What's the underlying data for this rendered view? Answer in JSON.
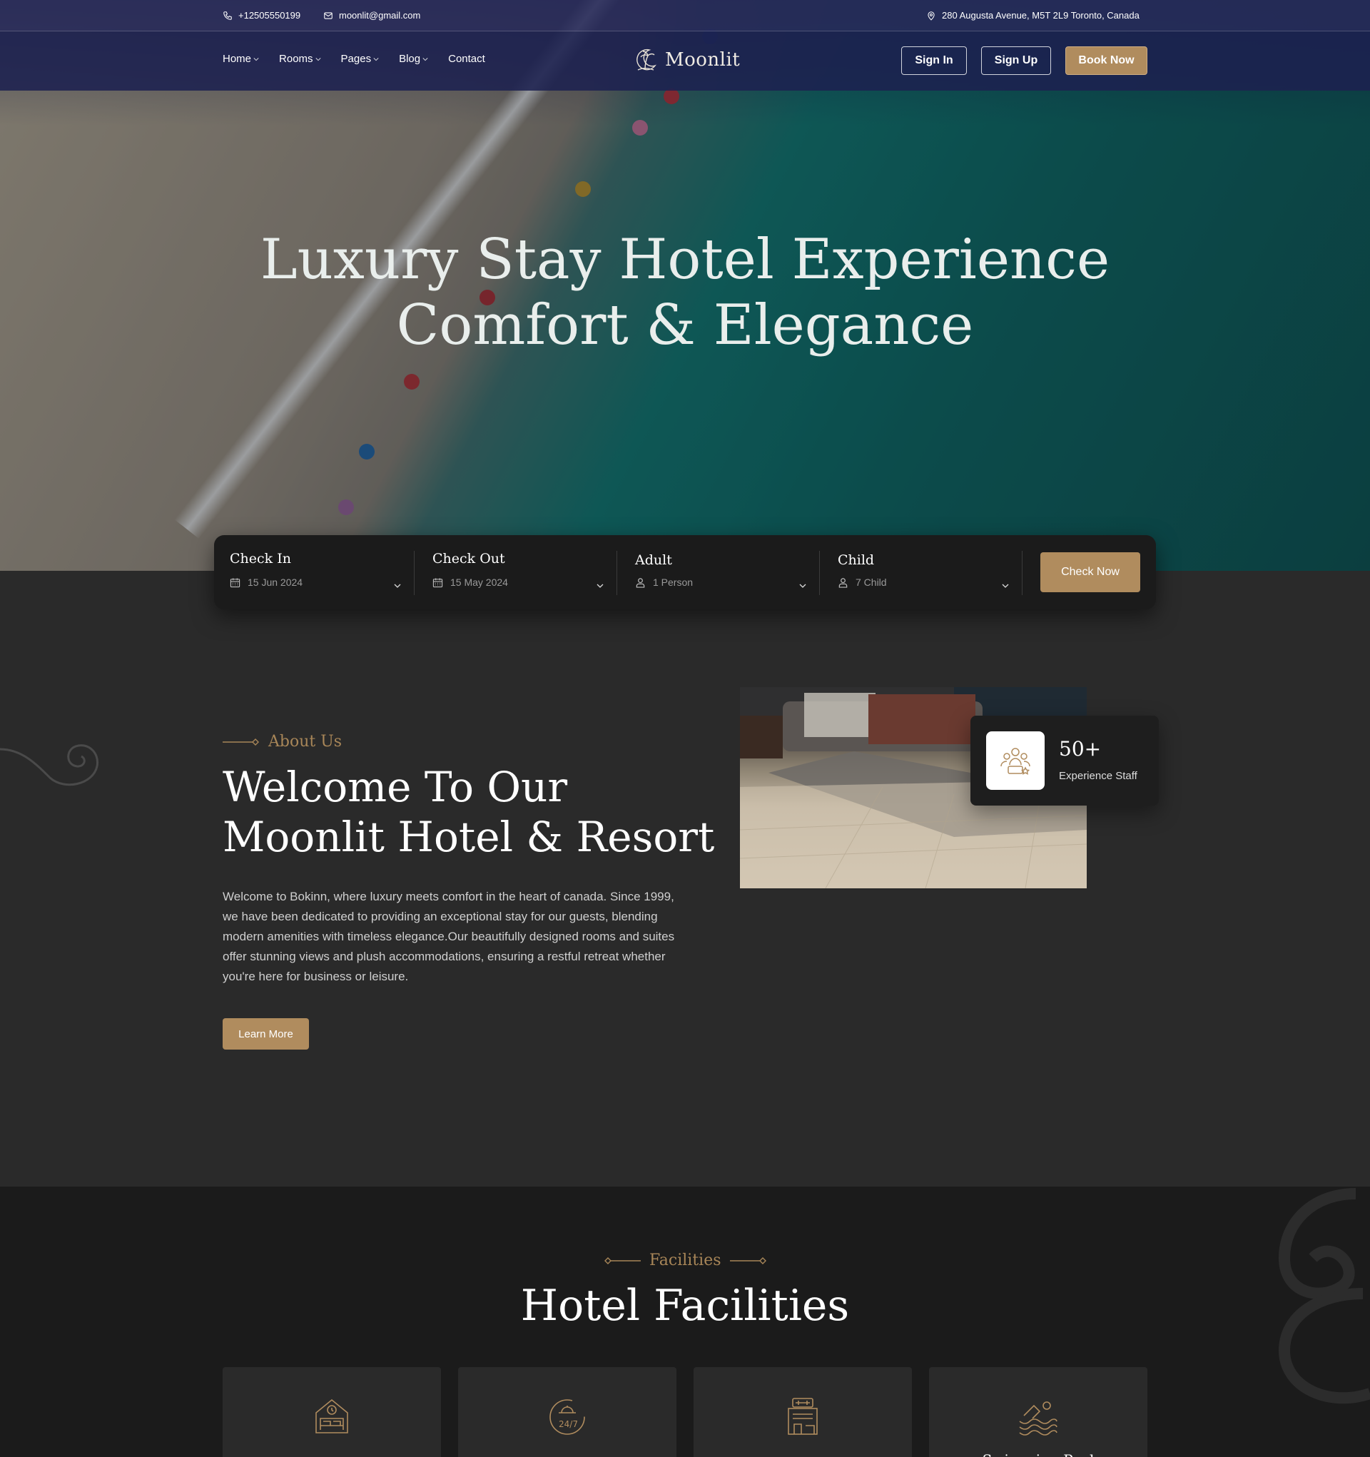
{
  "topbar": {
    "phone": "+12505550199",
    "email": "moonlit@gmail.com",
    "address": "280 Augusta Avenue, M5T 2L9 Toronto, Canada"
  },
  "nav": {
    "items": [
      {
        "label": "Home",
        "dropdown": true
      },
      {
        "label": "Rooms",
        "dropdown": true
      },
      {
        "label": "Pages",
        "dropdown": true
      },
      {
        "label": "Blog",
        "dropdown": true
      },
      {
        "label": "Contact",
        "dropdown": false
      }
    ],
    "logo": "Moonlit",
    "sign_in": "Sign In",
    "sign_up": "Sign Up",
    "book_now": "Book Now"
  },
  "hero": {
    "title_line1": "Luxury Stay Hotel Experience",
    "title_line2": "Comfort & Elegance"
  },
  "booking": {
    "check_in_label": "Check In",
    "check_in_value": "15 Jun 2024",
    "check_out_label": "Check Out",
    "check_out_value": "15 May 2024",
    "adult_label": "Adult",
    "adult_value": "1 Person",
    "child_label": "Child",
    "child_value": "7 Child",
    "button": "Check Now"
  },
  "about": {
    "eyebrow": "About Us",
    "title": "Welcome To Our Moonlit Hotel & Resort",
    "text": "Welcome to Bokinn, where luxury meets comfort in the heart of canada. Since 1999, we have been dedicated to providing an exceptional stay for our guests, blending modern amenities with timeless elegance.Our beautifully designed rooms and suites offer stunning views and plush accommodations, ensuring a restful retreat whether you're here for business or leisure.",
    "button": "Learn More",
    "stat_number": "50+",
    "stat_label": "Experience Staff"
  },
  "facilities": {
    "eyebrow": "Facilities",
    "title": "Hotel Facilities",
    "cards": [
      {
        "icon": "bed-clock-icon",
        "name": ""
      },
      {
        "icon": "24-7-service-icon",
        "name": ""
      },
      {
        "icon": "gym-icon",
        "name": ""
      },
      {
        "icon": "swimming-pool-icon",
        "name": "Swimming Pool"
      }
    ]
  },
  "colors": {
    "accent": "#b08c5e",
    "navy": "#1c2150",
    "dark": "#1b1b1b",
    "panel": "#2a2a2a"
  }
}
